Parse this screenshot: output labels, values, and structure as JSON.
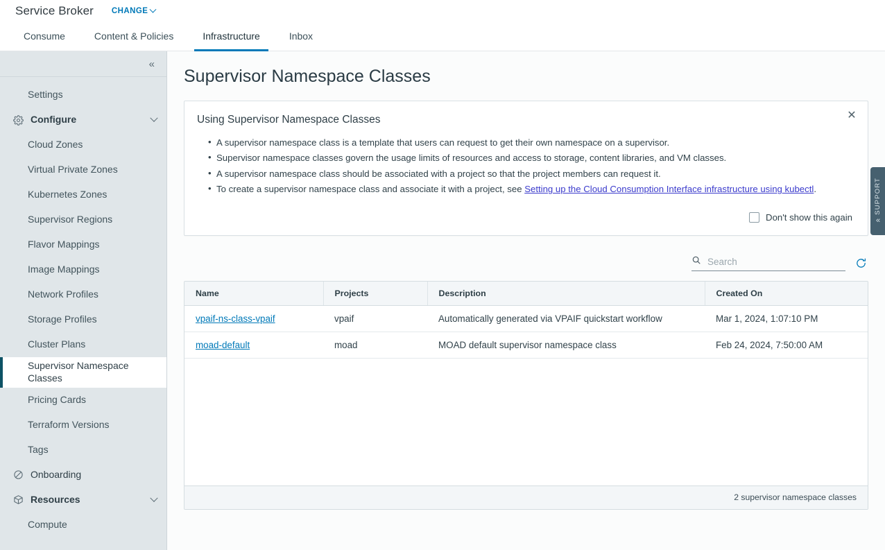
{
  "header": {
    "app_title": "Service Broker",
    "change_label": "CHANGE",
    "change_icon": "chevron-down-icon"
  },
  "tabs": [
    {
      "label": "Consume",
      "active": false
    },
    {
      "label": "Content & Policies",
      "active": false
    },
    {
      "label": "Infrastructure",
      "active": true
    },
    {
      "label": "Inbox",
      "active": false
    }
  ],
  "sidebar": {
    "collapse_icon": "double-chevron-left-icon",
    "accent_color": "#0d5265",
    "background_color": "#e0e6e9",
    "items": [
      {
        "label": "Settings",
        "type": "link",
        "icon": null,
        "selected": false
      },
      {
        "label": "Configure",
        "type": "group",
        "icon": "gear-icon",
        "selected": false,
        "expanded": true
      },
      {
        "label": "Cloud Zones",
        "type": "link",
        "icon": null,
        "selected": false
      },
      {
        "label": "Virtual Private Zones",
        "type": "link",
        "icon": null,
        "selected": false
      },
      {
        "label": "Kubernetes Zones",
        "type": "link",
        "icon": null,
        "selected": false
      },
      {
        "label": "Supervisor Regions",
        "type": "link",
        "icon": null,
        "selected": false
      },
      {
        "label": "Flavor Mappings",
        "type": "link",
        "icon": null,
        "selected": false
      },
      {
        "label": "Image Mappings",
        "type": "link",
        "icon": null,
        "selected": false
      },
      {
        "label": "Network Profiles",
        "type": "link",
        "icon": null,
        "selected": false
      },
      {
        "label": "Storage Profiles",
        "type": "link",
        "icon": null,
        "selected": false
      },
      {
        "label": "Cluster Plans",
        "type": "link",
        "icon": null,
        "selected": false
      },
      {
        "label": "Supervisor Namespace Classes",
        "type": "link",
        "icon": null,
        "selected": true
      },
      {
        "label": "Pricing Cards",
        "type": "link",
        "icon": null,
        "selected": false
      },
      {
        "label": "Terraform Versions",
        "type": "link",
        "icon": null,
        "selected": false
      },
      {
        "label": "Tags",
        "type": "link",
        "icon": null,
        "selected": false
      },
      {
        "label": "Onboarding",
        "type": "group",
        "icon": "no-entry-icon",
        "selected": false,
        "bold": false
      },
      {
        "label": "Resources",
        "type": "group",
        "icon": "cube-icon",
        "selected": false,
        "expanded": true
      },
      {
        "label": "Compute",
        "type": "link",
        "icon": null,
        "selected": false
      }
    ]
  },
  "main": {
    "page_title": "Supervisor Namespace Classes",
    "info_card": {
      "title": "Using Supervisor Namespace Classes",
      "close_icon": "close-icon",
      "bullets": [
        {
          "text": "A supervisor namespace class is a template that users can request to get their own namespace on a supervisor."
        },
        {
          "text": "Supervisor namespace classes govern the usage limits of resources and access to storage, content libraries, and VM classes."
        },
        {
          "text": "A supervisor namespace class should be associated with a project so that the project members can request it."
        },
        {
          "text": "To create a supervisor namespace class and associate it with a project, see ",
          "link_text": "Setting up the Cloud Consumption Interface infrastructure using kubectl",
          "suffix": "."
        }
      ],
      "dont_show_label": "Don't show this again",
      "dont_show_checked": false
    },
    "toolbar": {
      "search_placeholder": "Search",
      "search_value": "",
      "search_icon": "search-icon",
      "refresh_icon": "refresh-icon"
    },
    "table": {
      "columns": [
        "Name",
        "Projects",
        "Description",
        "Created On"
      ],
      "rows": [
        {
          "name": "vpaif-ns-class-vpaif",
          "projects": "vpaif",
          "description": "Automatically generated via VPAIF quickstart workflow",
          "created_on": "Mar 1, 2024, 1:07:10 PM"
        },
        {
          "name": "moad-default",
          "projects": "moad",
          "description": "MOAD default supervisor namespace class",
          "created_on": "Feb 24, 2024, 7:50:00 AM"
        }
      ],
      "footer_text": "2 supervisor namespace classes"
    }
  },
  "support": {
    "label": "SUPPORT",
    "chevron_icon": "double-chevron-left-icon"
  }
}
